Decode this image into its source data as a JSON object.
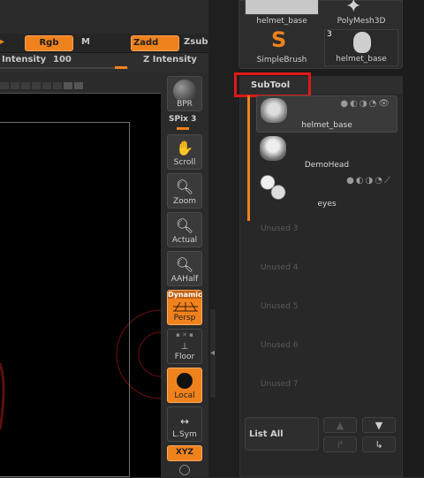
{
  "toolbar": {
    "rgb": "Rgb",
    "m": "M",
    "zadd": "Zadd",
    "zsub": "Zsub",
    "intensity_label": "Intensity",
    "intensity_value": "100",
    "z_intensity_label": "Z Intensity"
  },
  "shelf": {
    "bpr": "BPR",
    "spix_label": "SPix",
    "spix_value": "3",
    "scroll": "Scroll",
    "zoom": "Zoom",
    "actual": "Actual",
    "aahalf": "AAHalf",
    "dynamic": "Dynamic",
    "persp": "Persp",
    "floor": "Floor",
    "local": "Local",
    "lsym": "L.Sym",
    "xyz": "XYZ"
  },
  "tool_palette": {
    "items": [
      {
        "name": "helmet_base"
      },
      {
        "name": "PolyMesh3D"
      },
      {
        "name": "SimpleBrush"
      },
      {
        "name": "helmet_base",
        "badge": "3"
      }
    ]
  },
  "subtool": {
    "title": "SubTool",
    "items": [
      {
        "name": "helmet_base",
        "selected": true
      },
      {
        "name": "DemoHead"
      },
      {
        "name": "eyes"
      }
    ],
    "unused": [
      "Unused 3",
      "Unused 4",
      "Unused 5",
      "Unused 6",
      "Unused 7"
    ],
    "list_all": "List All"
  },
  "colors": {
    "accent": "#f0821e",
    "highlight": "#e01818"
  }
}
